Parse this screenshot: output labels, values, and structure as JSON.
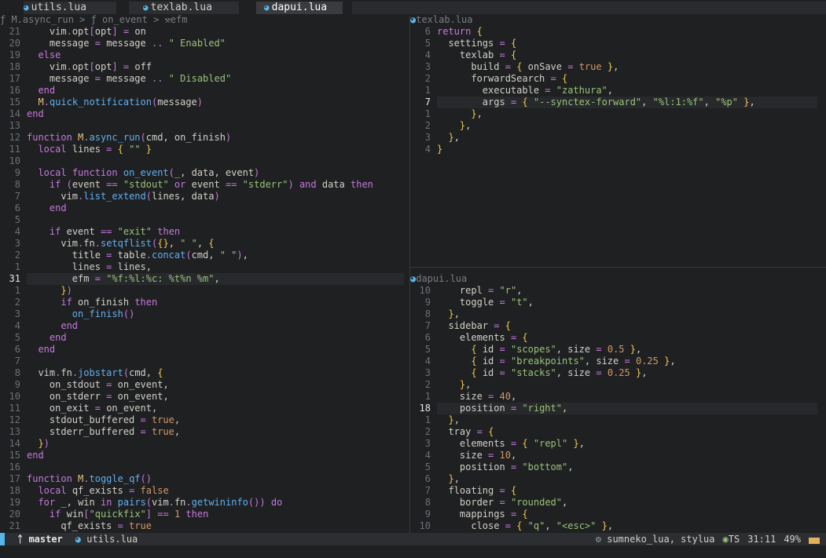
{
  "tabs": [
    {
      "icon": "lua-icon",
      "label": "utils.lua"
    },
    {
      "icon": "lua-icon",
      "label": "texlab.lua"
    },
    {
      "icon": "lua-icon",
      "label": "dapui.lua"
    }
  ],
  "left": {
    "breadcrumb": "ƒ M.async_run > ƒ on_event > ⚒efm",
    "lines": [
      {
        "ln": "21",
        "code": "    vim.opt[opt] = on"
      },
      {
        "ln": "20",
        "code": "    message = message .. \" Enabled\""
      },
      {
        "ln": "19",
        "code": "  else"
      },
      {
        "ln": "18",
        "code": "    vim.opt[opt] = off"
      },
      {
        "ln": "17",
        "code": "    message = message .. \" Disabled\""
      },
      {
        "ln": "16",
        "code": "  end"
      },
      {
        "ln": "15",
        "code": "  M.quick_notification(message)"
      },
      {
        "ln": "14",
        "code": "end"
      },
      {
        "ln": "13",
        "code": ""
      },
      {
        "ln": "12",
        "code": "function M.async_run(cmd, on_finish)"
      },
      {
        "ln": "11",
        "code": "  local lines = { \"\" }"
      },
      {
        "ln": "10",
        "code": ""
      },
      {
        "ln": "9",
        "code": "  local function on_event(_, data, event)"
      },
      {
        "ln": "8",
        "code": "    if (event == \"stdout\" or event == \"stderr\") and data then"
      },
      {
        "ln": "7",
        "code": "      vim.list_extend(lines, data)"
      },
      {
        "ln": "6",
        "code": "    end"
      },
      {
        "ln": "5",
        "code": ""
      },
      {
        "ln": "4",
        "code": "    if event == \"exit\" then"
      },
      {
        "ln": "3",
        "code": "      vim.fn.setqflist({}, \" \", {"
      },
      {
        "ln": "2",
        "code": "        title = table.concat(cmd, \" \"),"
      },
      {
        "ln": "1",
        "code": "        lines = lines,"
      },
      {
        "ln": "31",
        "code": "        efm = \"%f:%l:%c: %t%n %m\",",
        "current": true
      },
      {
        "ln": "1",
        "code": "      })"
      },
      {
        "ln": "2",
        "code": "      if on_finish then"
      },
      {
        "ln": "3",
        "code": "        on_finish()"
      },
      {
        "ln": "4",
        "code": "      end"
      },
      {
        "ln": "5",
        "code": "    end"
      },
      {
        "ln": "6",
        "code": "  end"
      },
      {
        "ln": "7",
        "code": ""
      },
      {
        "ln": "8",
        "code": "  vim.fn.jobstart(cmd, {"
      },
      {
        "ln": "9",
        "code": "    on_stdout = on_event,"
      },
      {
        "ln": "10",
        "code": "    on_stderr = on_event,"
      },
      {
        "ln": "11",
        "code": "    on_exit = on_event,"
      },
      {
        "ln": "12",
        "code": "    stdout_buffered = true,"
      },
      {
        "ln": "13",
        "code": "    stderr_buffered = true,"
      },
      {
        "ln": "14",
        "code": "  })"
      },
      {
        "ln": "15",
        "code": "end"
      },
      {
        "ln": "16",
        "code": ""
      },
      {
        "ln": "17",
        "code": "function M.toggle_qf()"
      },
      {
        "ln": "18",
        "code": "  local qf_exists = false"
      },
      {
        "ln": "19",
        "code": "  for _, win in pairs(vim.fn.getwininfo()) do"
      },
      {
        "ln": "20",
        "code": "    if win[\"quickfix\"] == 1 then"
      },
      {
        "ln": "21",
        "code": "      qf_exists = true"
      }
    ]
  },
  "topright": {
    "title": "texlab.lua",
    "lines": [
      {
        "ln": "6",
        "code": "return {"
      },
      {
        "ln": "5",
        "code": "  settings = {"
      },
      {
        "ln": "4",
        "code": "    texlab = {"
      },
      {
        "ln": "3",
        "code": "      build = { onSave = true },"
      },
      {
        "ln": "2",
        "code": "      forwardSearch = {"
      },
      {
        "ln": "1",
        "code": "        executable = \"zathura\","
      },
      {
        "ln": "7",
        "code": "        args = { \"--synctex-forward\", \"%l:1:%f\", \"%p\" },",
        "current": true
      },
      {
        "ln": "1",
        "code": "      },"
      },
      {
        "ln": "2",
        "code": "    },"
      },
      {
        "ln": "3",
        "code": "  },"
      },
      {
        "ln": "4",
        "code": "}"
      }
    ]
  },
  "bottomright": {
    "title": "dapui.lua",
    "lines": [
      {
        "ln": "10",
        "code": "    repl = \"r\","
      },
      {
        "ln": "9",
        "code": "    toggle = \"t\","
      },
      {
        "ln": "8",
        "code": "  },"
      },
      {
        "ln": "7",
        "code": "  sidebar = {"
      },
      {
        "ln": "6",
        "code": "    elements = {"
      },
      {
        "ln": "5",
        "code": "      { id = \"scopes\", size = 0.5 },"
      },
      {
        "ln": "4",
        "code": "      { id = \"breakpoints\", size = 0.25 },"
      },
      {
        "ln": "3",
        "code": "      { id = \"stacks\", size = 0.25 },"
      },
      {
        "ln": "2",
        "code": "    },"
      },
      {
        "ln": "1",
        "code": "    size = 40,"
      },
      {
        "ln": "18",
        "code": "    position = \"right\",",
        "current": true
      },
      {
        "ln": "1",
        "code": "  },"
      },
      {
        "ln": "2",
        "code": "  tray = {"
      },
      {
        "ln": "3",
        "code": "    elements = { \"repl\" },"
      },
      {
        "ln": "4",
        "code": "    size = 10,"
      },
      {
        "ln": "5",
        "code": "    position = \"bottom\","
      },
      {
        "ln": "6",
        "code": "  },"
      },
      {
        "ln": "7",
        "code": "  floating = {"
      },
      {
        "ln": "8",
        "code": "    border = \"rounded\","
      },
      {
        "ln": "9",
        "code": "    mappings = {"
      },
      {
        "ln": "10",
        "code": "      close = { \"q\", \"<esc>\" },"
      }
    ]
  },
  "status": {
    "branch_icon": "git-branch-icon",
    "branch": "master",
    "file_icon": "lua-icon",
    "file": "utils.lua",
    "lsp": "sumneko_lua, stylua",
    "ts": "TS",
    "position": "31:11",
    "percent": "49%"
  },
  "colors": {
    "bg": "#1f2022",
    "accent": "#56b6e8",
    "keyword": "#c678dd",
    "function": "#61afef",
    "string": "#98c379",
    "param": "#e06c75"
  }
}
